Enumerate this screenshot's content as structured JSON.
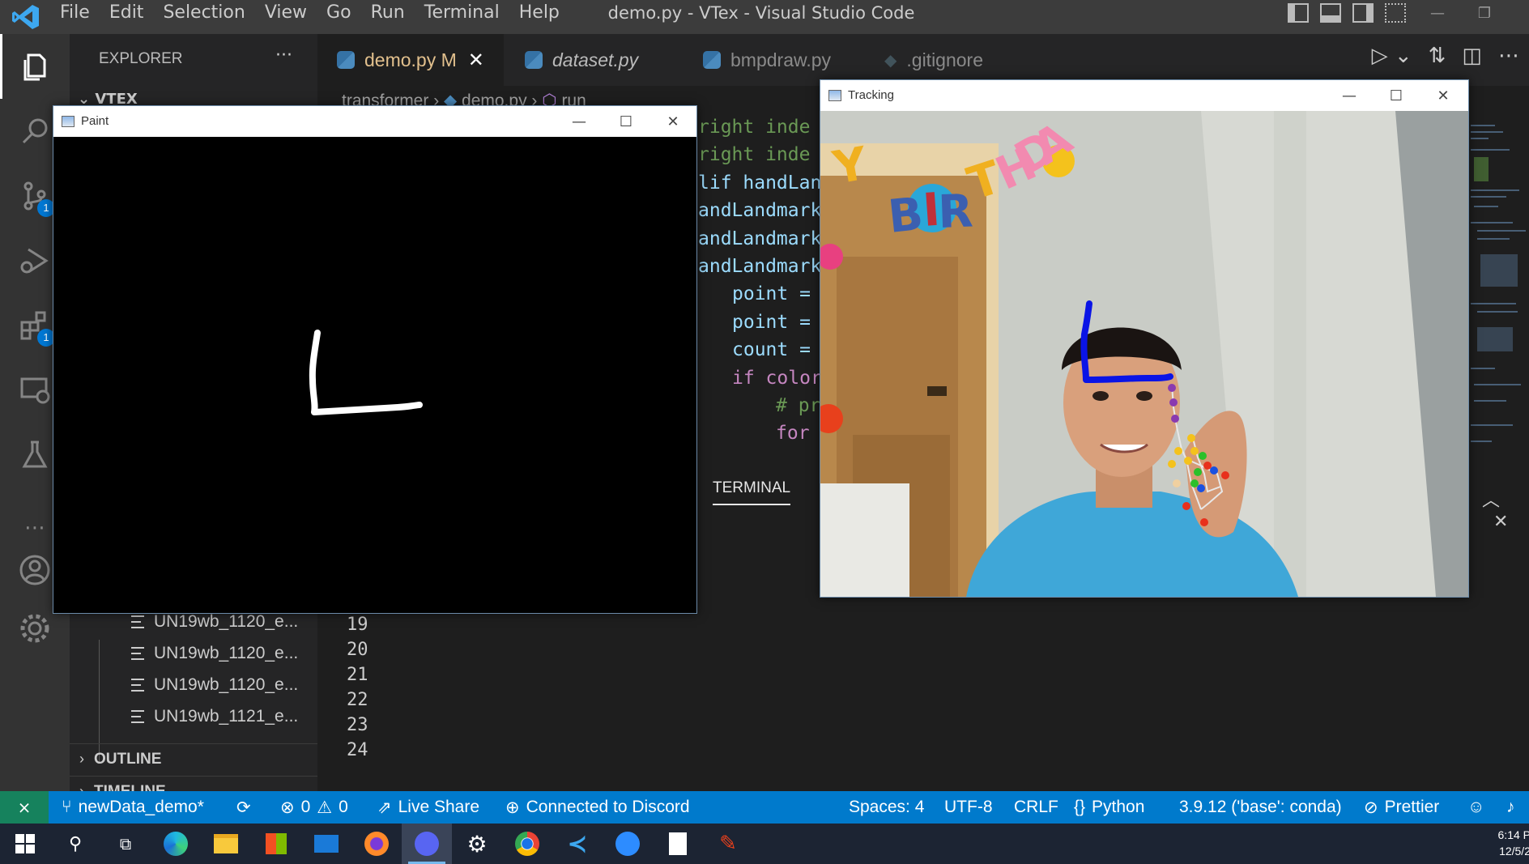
{
  "titlebar": {
    "menu": [
      "File",
      "Edit",
      "Selection",
      "View",
      "Go",
      "Run",
      "Terminal",
      "Help"
    ],
    "window_title": "demo.py - VTex - Visual Studio Code"
  },
  "activitybar": {
    "badges": {
      "source_control": "1",
      "extensions": "1"
    }
  },
  "sidebar": {
    "explorer_title": "EXPLORER",
    "more": "···",
    "root_folder": "VTEX",
    "files": [
      "UN19wb_1120_e...",
      "UN19wb_1120_e...",
      "UN19wb_1120_e...",
      "UN19wb_1121_e..."
    ],
    "sections": [
      "OUTLINE",
      "TIMELINE"
    ]
  },
  "editor": {
    "tabs": [
      {
        "label": "demo.py",
        "suffix": "M"
      },
      {
        "label": "dataset.py"
      },
      {
        "label": "bmpdraw.py"
      },
      {
        "label": ".gitignore"
      }
    ],
    "breadcrumb": [
      "transformer",
      "demo.py",
      "run"
    ],
    "code_lines": [
      "right inde",
      "right inde",
      "lif handLan",
      "andLandmark",
      "andLandmark",
      "andLandmark",
      "point =",
      "point =",
      "count =",
      "if color",
      "# pr",
      "for"
    ],
    "line_numbers": [
      "19",
      "20",
      "21",
      "22",
      "23",
      "24"
    ],
    "panel_tab": "TERMINAL"
  },
  "paint_window": {
    "title": "Paint"
  },
  "tracking_window": {
    "title": "Tracking",
    "banner_text": "BIRTHDAY"
  },
  "statusbar": {
    "branch": "newData_demo*",
    "errors": "0",
    "warnings": "0",
    "live_share": "Live Share",
    "discord": "Connected to Discord",
    "spaces": "Spaces: 4",
    "encoding": "UTF-8",
    "eol": "CRLF",
    "language": "Python",
    "interpreter": "3.9.12 ('base': conda)",
    "formatter": "Prettier"
  },
  "taskbar": {
    "time": "6:14 P",
    "date": "12/5/2"
  },
  "colors": {
    "statusbar": "#007acc",
    "remote": "#16825d",
    "titlebar": "#3c3c3c",
    "activitybar": "#333333",
    "sidebar": "#252526",
    "editor": "#1e1e1e",
    "modified_tab": "#e2c08d",
    "drawn_stroke": "#0a14e6"
  }
}
